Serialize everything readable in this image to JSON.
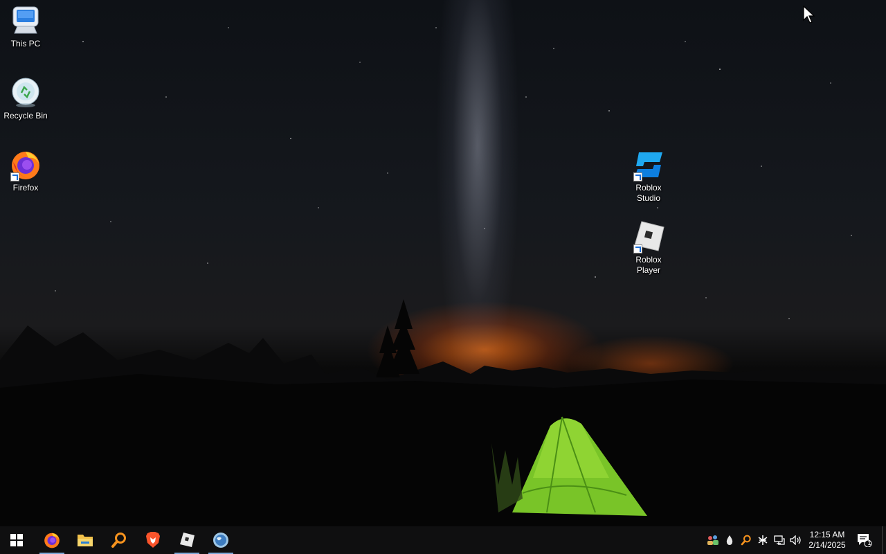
{
  "desktop": {
    "icons": [
      {
        "label": "This PC",
        "icon": "this-pc-icon"
      },
      {
        "label": "Recycle Bin",
        "icon": "recycle-bin-icon"
      },
      {
        "label": "Firefox",
        "icon": "firefox-icon"
      },
      {
        "label": "Roblox Studio",
        "icon": "roblox-studio-icon"
      },
      {
        "label": "Roblox Player",
        "icon": "roblox-player-icon"
      }
    ]
  },
  "taskbar": {
    "start": "start-icon",
    "apps": [
      {
        "name": "Firefox",
        "icon": "firefox-icon",
        "active": true
      },
      {
        "name": "File Explorer",
        "icon": "folder-icon",
        "active": false
      },
      {
        "name": "Search",
        "icon": "search-icon",
        "active": false
      },
      {
        "name": "Brave",
        "icon": "brave-icon",
        "active": false
      },
      {
        "name": "Roblox Player",
        "icon": "roblox-icon",
        "active": true
      },
      {
        "name": "Globe app",
        "icon": "globe-icon",
        "active": true
      }
    ],
    "tray": [
      "people-icon",
      "drop-icon",
      "search-tray-icon",
      "bluetooth-icon",
      "network-icon",
      "volume-icon"
    ],
    "clock": {
      "time": "12:15 AM",
      "date": "2/14/2025"
    },
    "notifications": {
      "count": "1"
    }
  },
  "colors": {
    "taskbar": "#0f0f10",
    "active_underline": "#7aa7d6",
    "tent": "#7fcf2a",
    "glow": "#f06e14"
  }
}
